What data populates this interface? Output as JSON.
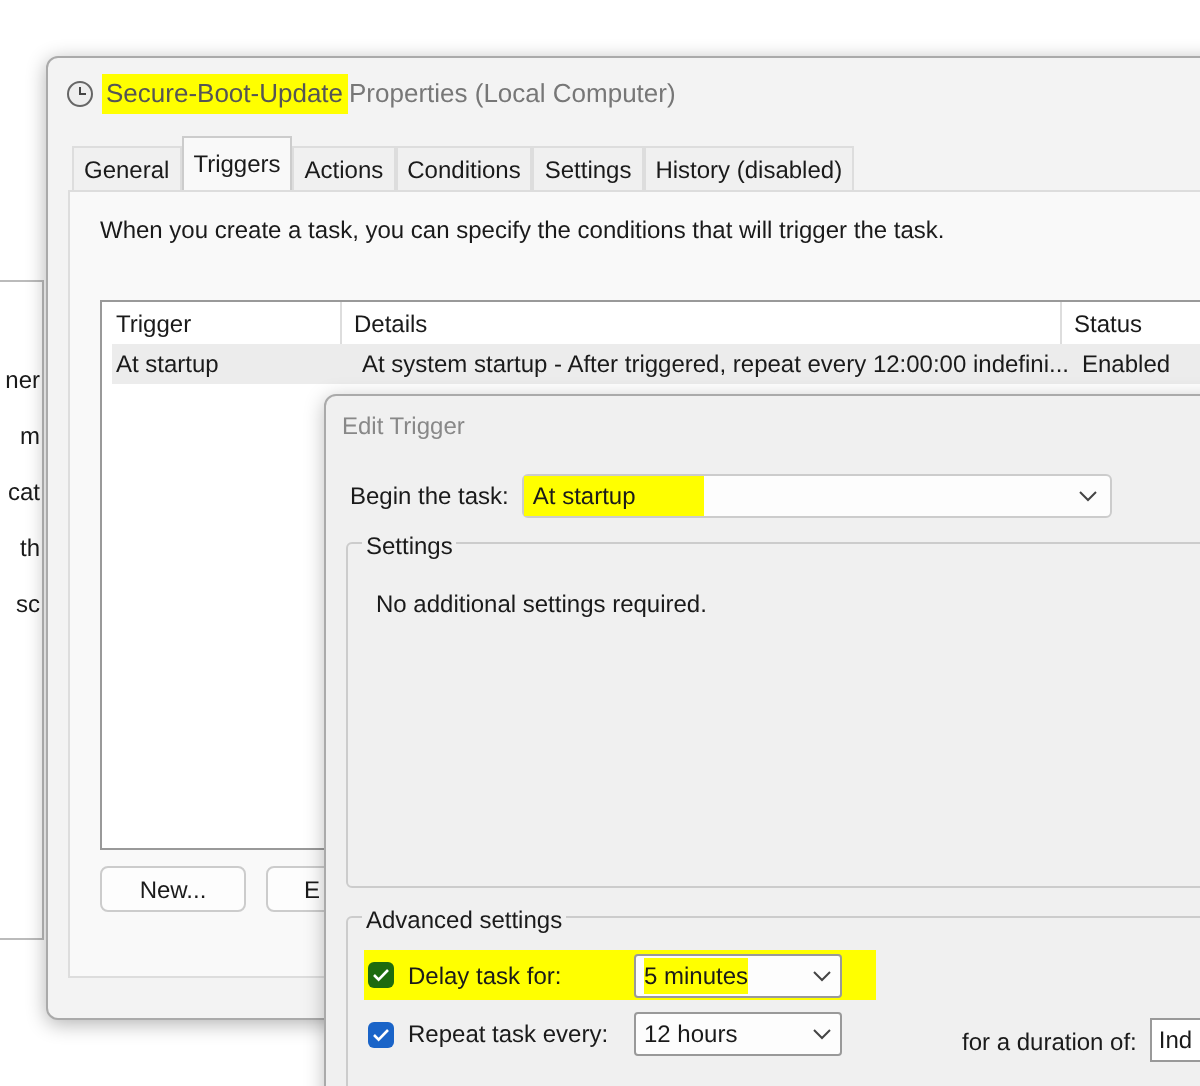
{
  "background_window": {
    "fragments": [
      "ner",
      "m",
      "cat",
      "th",
      "sc"
    ]
  },
  "window": {
    "title_highlighted": "Secure-Boot-Update",
    "title_rest": "Properties (Local Computer)"
  },
  "tabs": [
    {
      "label": "General",
      "selected": false
    },
    {
      "label": "Triggers",
      "selected": true
    },
    {
      "label": "Actions",
      "selected": false
    },
    {
      "label": "Conditions",
      "selected": false
    },
    {
      "label": "Settings",
      "selected": false
    },
    {
      "label": "History (disabled)",
      "selected": false
    }
  ],
  "description": "When you create a task, you can specify the conditions that will trigger the task.",
  "table": {
    "columns": [
      "Trigger",
      "Details",
      "Status"
    ],
    "rows": [
      {
        "cells": [
          "At startup",
          "At system startup - After triggered, repeat every 12:00:00 indefini...",
          "Enabled"
        ],
        "selected": true
      }
    ]
  },
  "buttons": [
    "New...",
    "E"
  ],
  "edit_trigger": {
    "title": "Edit Trigger",
    "begin_label": "Begin the task:",
    "begin_value": "At startup",
    "begin_highlighted": true,
    "settings_label": "Settings",
    "settings_text": "No additional settings required.",
    "advanced_label": "Advanced settings",
    "advanced_rows": [
      {
        "label": "Delay task for:",
        "checked": true,
        "value": "5 minutes",
        "highlighted": true
      },
      {
        "label": "Repeat task every:",
        "checked": true,
        "value": "12 hours",
        "highlighted": false,
        "extra_label": "for a duration of:",
        "extra_value": "Ind"
      }
    ]
  }
}
